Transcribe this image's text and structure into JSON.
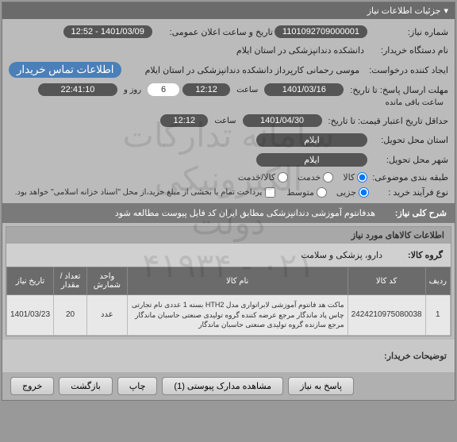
{
  "header": {
    "title": "جزئیات اطلاعات نیاز"
  },
  "fields": {
    "need_no_lbl": "شماره نیاز:",
    "need_no": "1101092709000001",
    "public_date_lbl": "تاریخ و ساعت اعلان عمومی:",
    "public_date": "1401/03/09 - 12:52",
    "buyer_org_lbl": "نام دستگاه خریدار:",
    "buyer_org": "دانشکده دندانپزشکی در استان ایلام",
    "requester_lbl": "ایجاد کننده درخواست:",
    "requester": "موسی رحمانی کارپرداز دانشکده دندانپزشکی در استان ایلام",
    "contact_btn": "اطلاعات تماس خریدار",
    "deadline_lbl": "مهلت ارسال پاسخ: تا تاریخ:",
    "deadline_date": "1401/03/16",
    "hour_lbl": "ساعت",
    "deadline_hour": "12:12",
    "days_pre": "روز و",
    "remain_days": "6",
    "remain_time": "22:41:10",
    "remain_suf": "ساعت باقی مانده",
    "valid_lbl": "حداقل تاریخ اعتبار قیمت: تا تاریخ:",
    "valid_date": "1401/04/30",
    "valid_hour": "12:12",
    "province_lbl": "استان محل تحویل:",
    "province": "ایلام",
    "city_lbl": "شهر محل تحویل:",
    "city": "ایلام",
    "topic_class_lbl": "طبقه بندی موضوعی:",
    "topic_goods": "کالا",
    "topic_service": "خدمت",
    "topic_both": "کالا/خدمت",
    "buy_type_lbl": "نوع فرآیند خرید :",
    "buy_partial": "جزیی",
    "buy_medium": "متوسط",
    "buy_note": "پرداخت تمام یا بخشی از مبلغ خرید،از محل \"اسناد خزانه اسلامی\" خواهد بود."
  },
  "overall_desc": {
    "lbl": "شرح کلی نیاز:",
    "txt": "هدفانتوم آموزشی دندانپزشکی مطابق ایران کد فایل پیوست مطالعه شود"
  },
  "goods": {
    "header": "اطلاعات کالاهای مورد نیاز",
    "group_lbl": "گروه کالا:",
    "group_val": "دارو، پزشکی و سلامت",
    "cols": {
      "row": "ردیف",
      "code": "کد کالا",
      "name": "نام کالا",
      "unit": "واحد شمارش",
      "qty": "تعداد / مقدار",
      "date": "تاریخ نیاز"
    },
    "rows": [
      {
        "idx": "1",
        "code": "2424210975080038",
        "name": "ماکت هد فانتوم آموزشی لابراتواری مدل HTH2 بسته 1 عددی نام تجارتی چاس پاد ماندگار مرجع عرضه کننده گروه تولیدی صنعتی حاسبان ماندگار مرجع سازنده گروه تولیدی صنعتی حاسبان ماندگار",
        "unit": "عدد",
        "qty": "20",
        "date": "1401/03/23"
      }
    ]
  },
  "notes_lbl": "توضیحات خریدار:",
  "buttons": {
    "respond": "پاسخ به نیاز",
    "attach": "مشاهده مدارک پیوستی (1)",
    "print": "چاپ",
    "back": "بازگشت",
    "exit": "خروج"
  },
  "wm_line1": "سامانه تدارکات الکترونیکی دولت",
  "wm_line2": "۰۲۱ - ۴۱۹۳۴"
}
